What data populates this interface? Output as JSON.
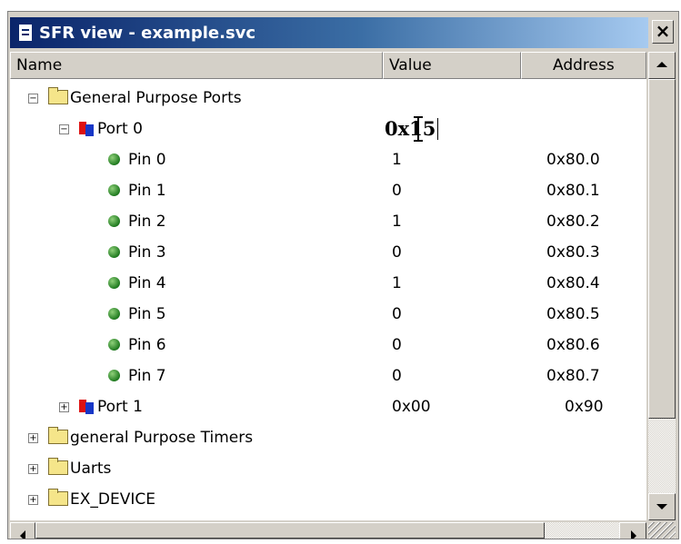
{
  "window": {
    "title": "SFR view - example.svc",
    "close_glyph": "×"
  },
  "columns": {
    "name": "Name",
    "value": "Value",
    "address": "Address"
  },
  "tree": {
    "gpp": "General Purpose Ports",
    "port0": {
      "label": "Port 0",
      "value_edit": "0x15"
    },
    "pins": [
      {
        "label": "Pin 0",
        "value": "1",
        "address": "0x80.0"
      },
      {
        "label": "Pin 1",
        "value": "0",
        "address": "0x80.1"
      },
      {
        "label": "Pin 2",
        "value": "1",
        "address": "0x80.2"
      },
      {
        "label": "Pin 3",
        "value": "0",
        "address": "0x80.3"
      },
      {
        "label": "Pin 4",
        "value": "1",
        "address": "0x80.4"
      },
      {
        "label": "Pin 5",
        "value": "0",
        "address": "0x80.5"
      },
      {
        "label": "Pin 6",
        "value": "0",
        "address": "0x80.6"
      },
      {
        "label": "Pin 7",
        "value": "0",
        "address": "0x80.7"
      }
    ],
    "port1": {
      "label": "Port 1",
      "value": "0x00",
      "address": "0x90"
    },
    "gpt": "general Purpose Timers",
    "uarts": "Uarts",
    "exdev": "EX_DEVICE"
  },
  "expanders": {
    "expanded": "−",
    "collapsed": "+"
  },
  "icons": {
    "folder": "folder-icon",
    "port": "port-icon",
    "pin": "pin-led-icon"
  }
}
